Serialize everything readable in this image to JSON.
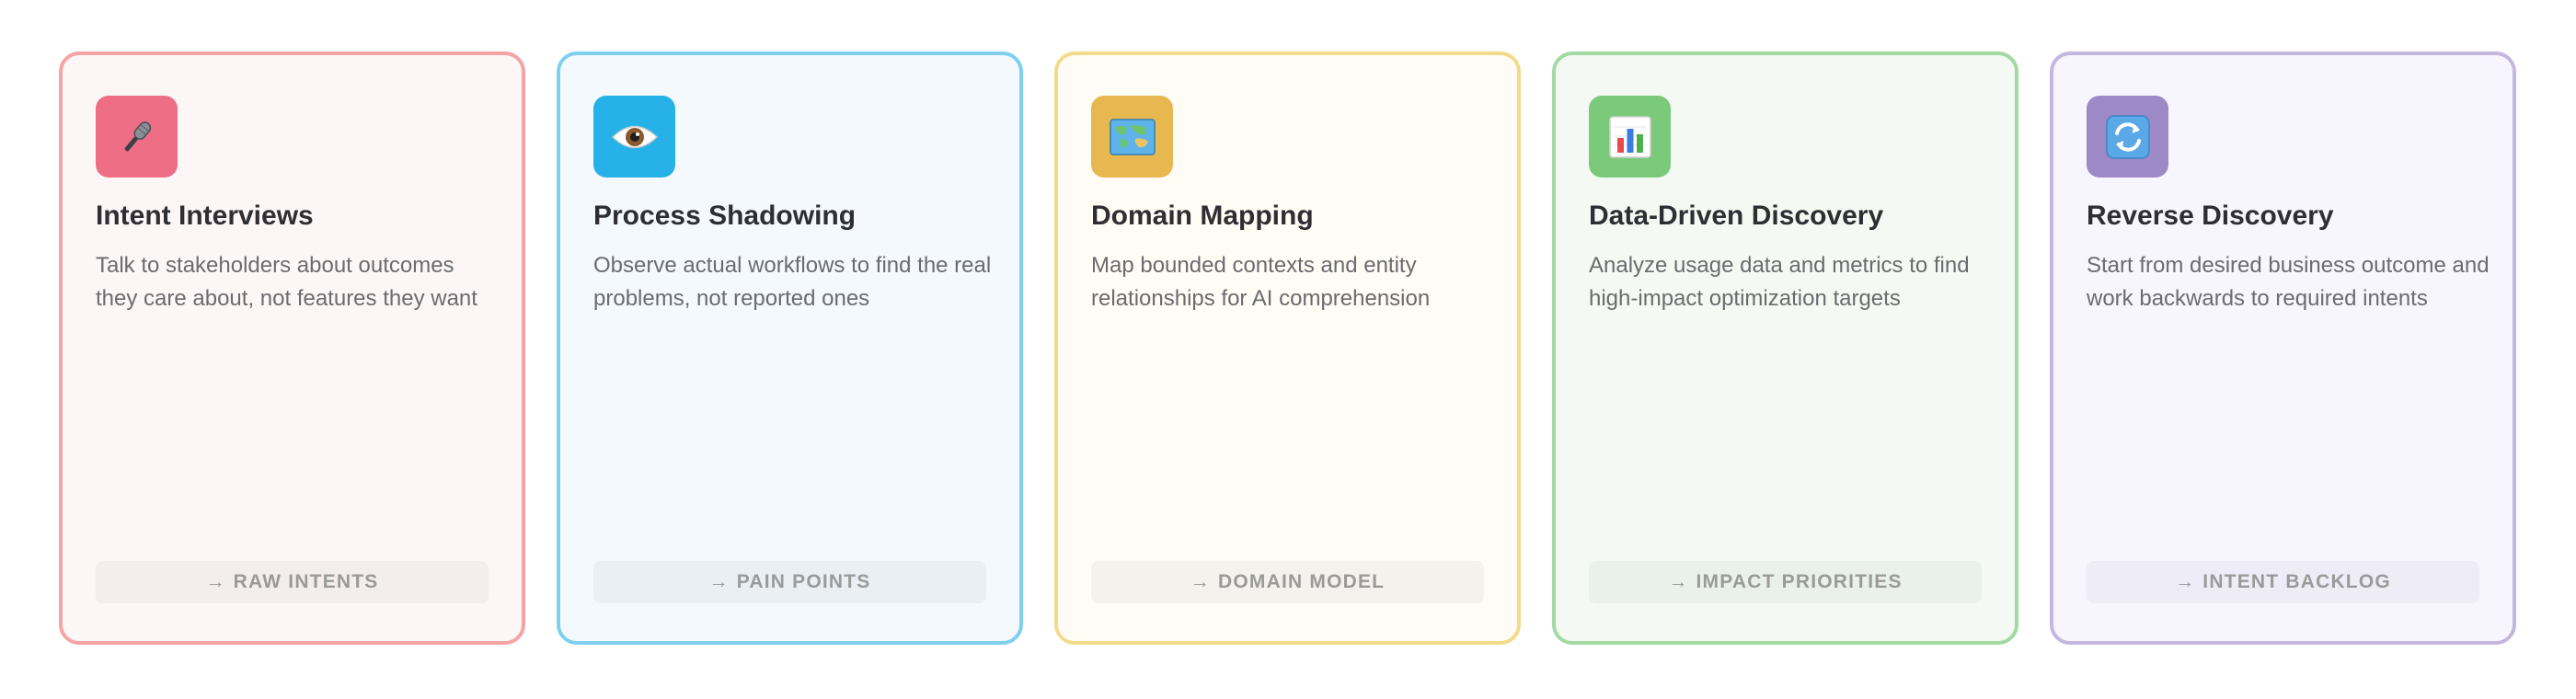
{
  "cards": [
    {
      "icon": "microphone-icon",
      "title": "Intent Interviews",
      "description": "Talk to stakeholders about outcomes they care about, not features they want",
      "output_arrow": "→",
      "output": "RAW INTENTS",
      "accent": "#ee6e85"
    },
    {
      "icon": "eye-icon",
      "title": "Process Shadowing",
      "description": "Observe actual workflows to find the real problems, not reported ones",
      "output_arrow": "→",
      "output": "PAIN POINTS",
      "accent": "#26b2e8"
    },
    {
      "icon": "world-map-icon",
      "title": "Domain Mapping",
      "description": "Map bounded contexts and entity relationships for AI comprehension",
      "output_arrow": "→",
      "output": "DOMAIN MODEL",
      "accent": "#e7b84f"
    },
    {
      "icon": "bar-chart-icon",
      "title": "Data-Driven Discovery",
      "description": "Analyze usage data and metrics to find high-impact optimization targets",
      "output_arrow": "→",
      "output": "IMPACT PRIORITIES",
      "accent": "#7bc97b"
    },
    {
      "icon": "refresh-arrows-icon",
      "title": "Reverse Discovery",
      "description": "Start from desired business outcome and work backwards to required intents",
      "output_arrow": "→",
      "output": "INTENT BACKLOG",
      "accent": "#9c89c6"
    }
  ]
}
